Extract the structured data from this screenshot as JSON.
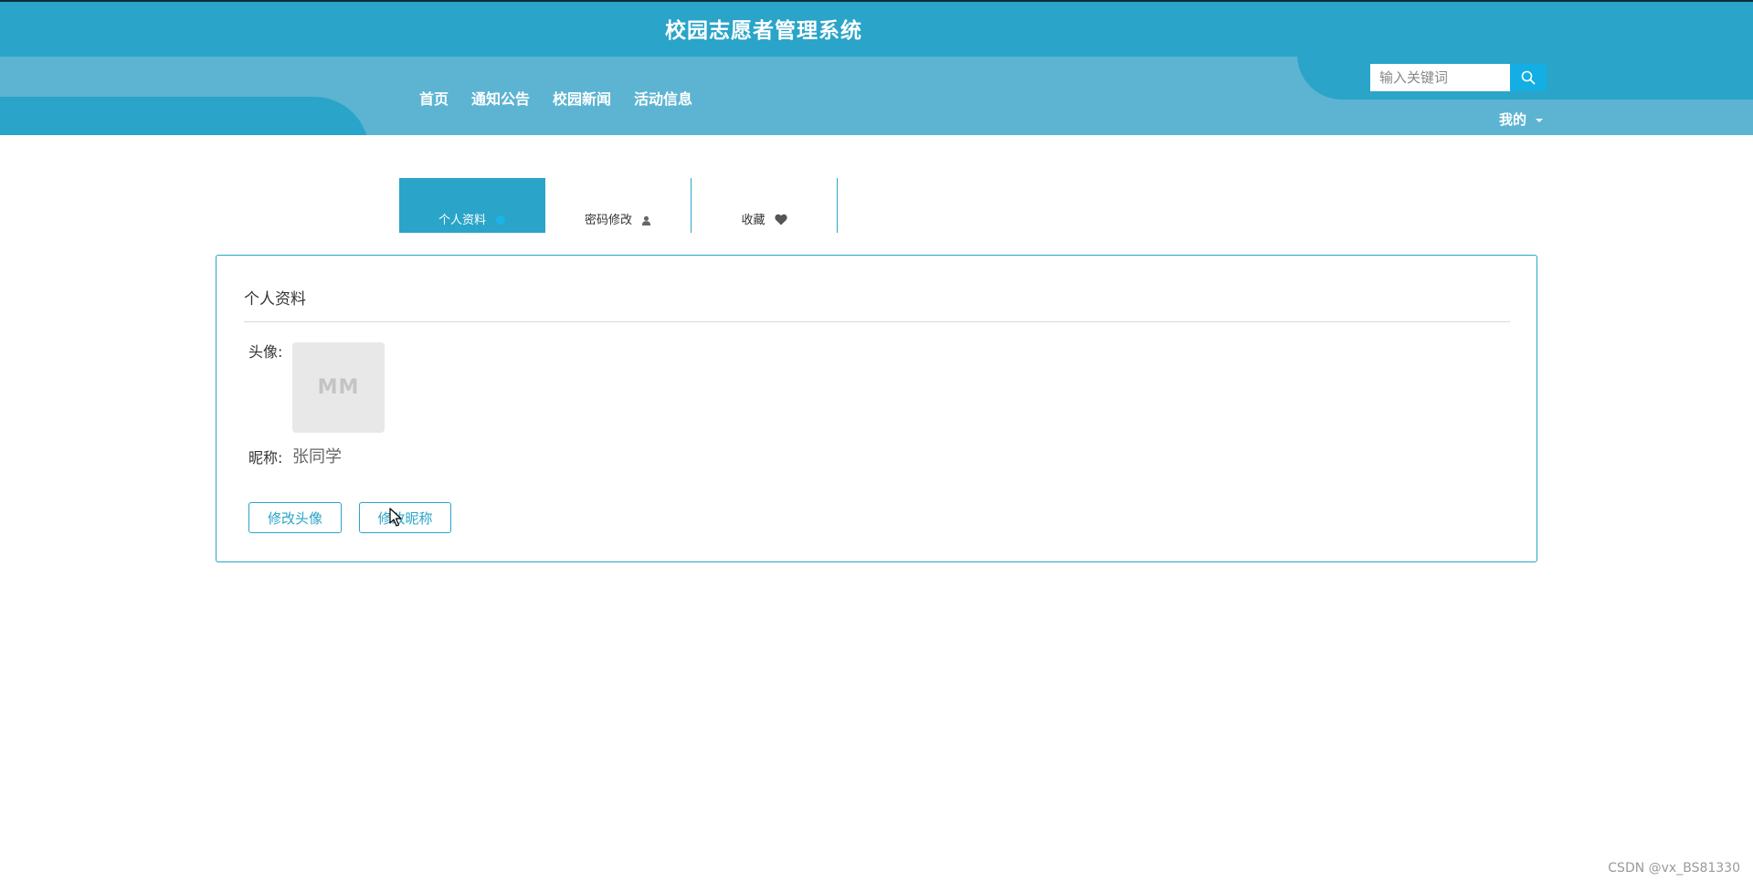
{
  "header": {
    "site_title": "校园志愿者管理系统",
    "nav": [
      {
        "label": "首页"
      },
      {
        "label": "通知公告"
      },
      {
        "label": "校园新闻"
      },
      {
        "label": "活动信息"
      }
    ],
    "search": {
      "placeholder": "输入关键词",
      "value": "",
      "icon": "search-icon"
    },
    "user_menu": {
      "label": "我的",
      "icon": "caret-down-icon"
    },
    "colors": {
      "primary": "#2aa4c9",
      "band": "#5cb4d2",
      "search_button": "#13aee3"
    }
  },
  "tabs": [
    {
      "label": "个人资料",
      "icon": "dot-icon",
      "active": true
    },
    {
      "label": "密码修改",
      "icon": "user-icon",
      "active": false
    },
    {
      "label": "收藏",
      "icon": "heart-icon",
      "active": false
    }
  ],
  "profile": {
    "title": "个人资料",
    "avatar_label": "头像:",
    "avatar_placeholder": "MM",
    "nickname_label": "昵称:",
    "nickname_value": "张同学",
    "change_avatar_button": "修改头像",
    "change_nickname_button": "修改昵称"
  },
  "watermark": "CSDN @vx_BS81330"
}
